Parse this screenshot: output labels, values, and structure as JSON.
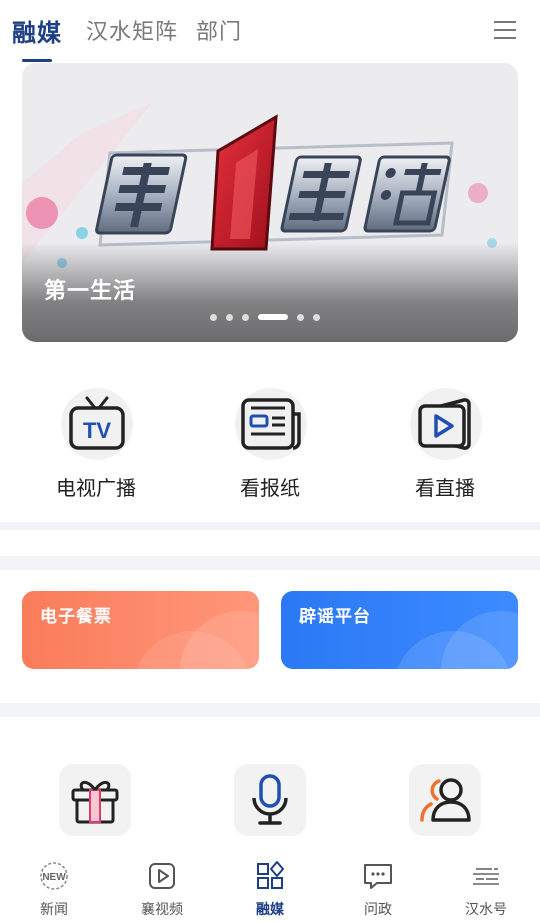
{
  "top_tabs": {
    "items": [
      {
        "label": "融媒",
        "active": true
      },
      {
        "label": "汉水矩阵",
        "active": false
      },
      {
        "label": "部门",
        "active": false
      }
    ],
    "menu_icon": "hamburger-menu-icon"
  },
  "banner": {
    "artwork_title": "第1生活",
    "caption": "第一生活",
    "slide_count": 6,
    "active_slide": 4
  },
  "media_shortcuts": [
    {
      "label": "电视广播",
      "icon": "tv-icon"
    },
    {
      "label": "看报纸",
      "icon": "newspaper-icon"
    },
    {
      "label": "看直播",
      "icon": "live-play-icon"
    }
  ],
  "service_cards": [
    {
      "label": "电子餐票",
      "color": "#fa7c5a"
    },
    {
      "label": "辟谣平台",
      "color": "#2b78f5"
    }
  ],
  "apps_row": [
    {
      "icon": "gift-icon"
    },
    {
      "icon": "microphone-icon"
    },
    {
      "icon": "users-icon"
    }
  ],
  "bottom_nav": [
    {
      "label": "新闻",
      "icon": "new-badge-icon",
      "badge_text": "NEW",
      "active": false
    },
    {
      "label": "襄视频",
      "icon": "video-play-icon",
      "active": false
    },
    {
      "label": "融媒",
      "icon": "grid-diamond-icon",
      "active": true
    },
    {
      "label": "问政",
      "icon": "chat-bubble-icon",
      "active": false
    },
    {
      "label": "汉水号",
      "icon": "waves-icon",
      "active": false
    }
  ],
  "colors": {
    "brand": "#1c3f86",
    "tv_icon_accent": "#1f4fb3",
    "live_icon_accent": "#1f4fb3",
    "users_icon_accent": "#f2702d",
    "gift_icon_accent": "#e23d6a"
  }
}
